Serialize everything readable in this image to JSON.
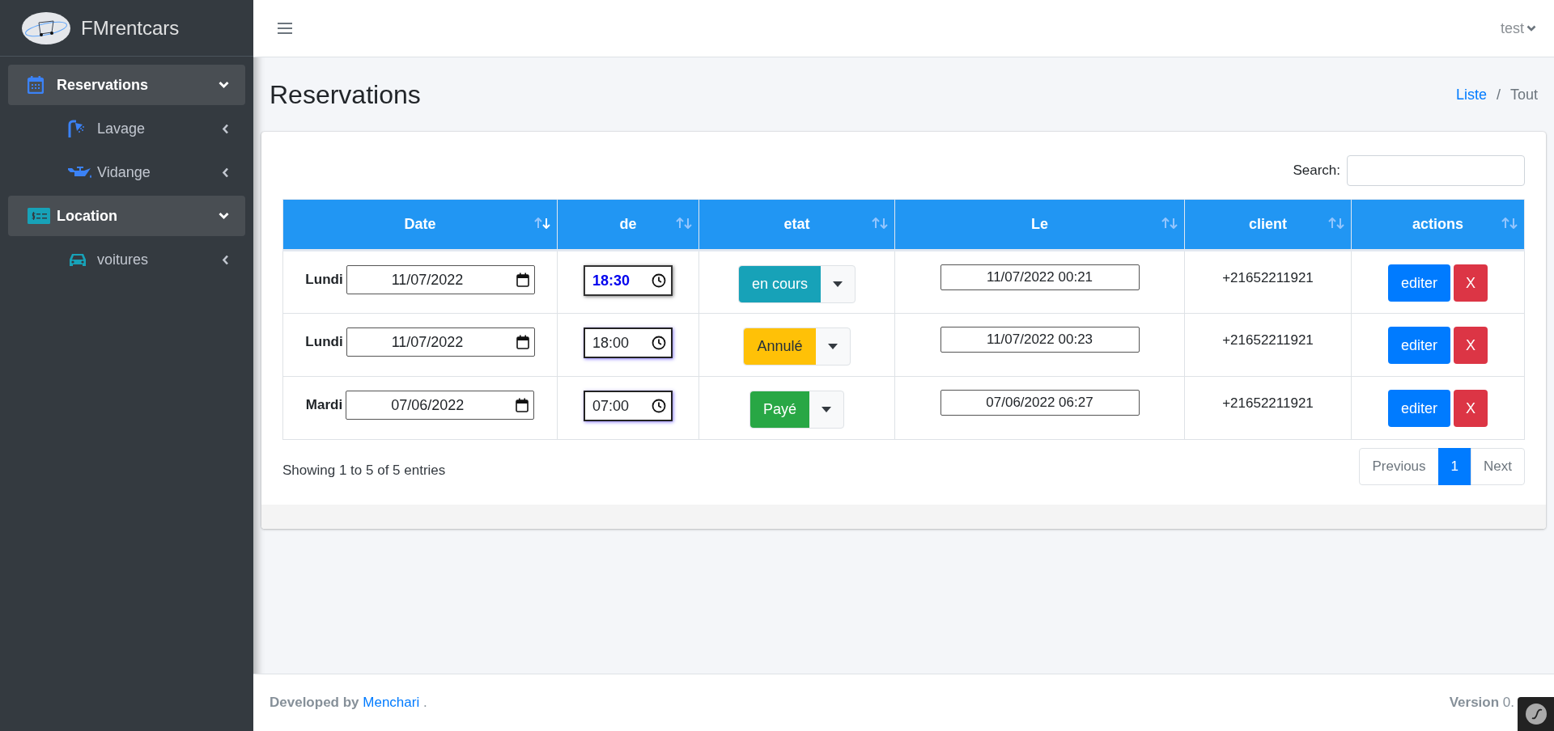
{
  "brand": {
    "name": "FMrentcars"
  },
  "sidebar": {
    "items": [
      {
        "label": "Reservations",
        "expanded": true,
        "children": [
          {
            "label": "Lavage",
            "expanded": false
          },
          {
            "label": "Vidange",
            "expanded": false
          }
        ]
      },
      {
        "label": "Location",
        "expanded": true,
        "children": [
          {
            "label": "voitures",
            "expanded": false
          }
        ]
      }
    ]
  },
  "topbar": {
    "user": "test"
  },
  "page": {
    "title": "Reservations",
    "breadcrumb": [
      {
        "label": "Liste",
        "kind": "link"
      },
      {
        "label": "Tout",
        "kind": "current"
      }
    ],
    "breadcrumb_separator": "/"
  },
  "search": {
    "label": "Search:"
  },
  "table": {
    "columns": [
      {
        "label": "Date",
        "sorted": true
      },
      {
        "label": "de",
        "sorted": false
      },
      {
        "label": "etat",
        "sorted": false
      },
      {
        "label": "Le",
        "sorted": false
      },
      {
        "label": "client",
        "sorted": false
      },
      {
        "label": "actions",
        "sorted": false
      }
    ],
    "rows": [
      {
        "day": "Lundi",
        "date": "11/07/2022",
        "time": "18:30",
        "time_focused": true,
        "status": "en cours",
        "kind": "info",
        "created": "11/07/2022 00:21",
        "client": "+21652211921",
        "edit": "editer",
        "delete": "X"
      },
      {
        "day": "Lundi",
        "date": "11/07/2022",
        "time": "18:00",
        "time_focused": false,
        "status": "Annulé",
        "kind": "warning",
        "created": "11/07/2022 00:23",
        "client": "+21652211921",
        "edit": "editer",
        "delete": "X"
      },
      {
        "day": "Mardi",
        "date": "07/06/2022",
        "time": "07:00",
        "time_focused": false,
        "status": "Payé",
        "kind": "success",
        "created": "07/06/2022 06:27",
        "client": "+21652211921",
        "edit": "editer",
        "delete": "X"
      }
    ]
  },
  "info": "Showing 1 to 5 of 5 entries",
  "pagination": [
    {
      "label": "Previous",
      "selected": false
    },
    {
      "label": "1",
      "selected": true
    },
    {
      "label": "Next",
      "selected": false
    }
  ],
  "footer": {
    "developed": "Developed by",
    "author": "Menchari",
    "period": ".",
    "version_label": "Version",
    "version": "0."
  }
}
